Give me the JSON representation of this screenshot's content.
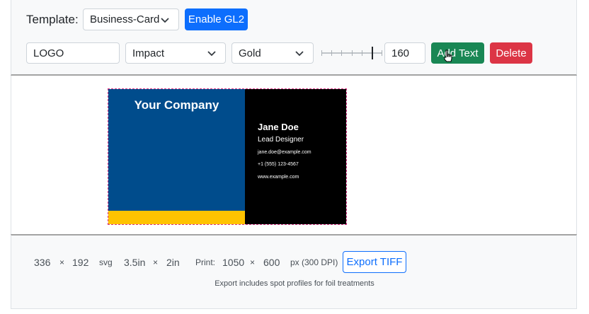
{
  "toolbar": {
    "template_label": "Template:",
    "template_value": "Business-Card",
    "enable_gl2_label": "Enable GL2",
    "text_value": "LOGO",
    "font_value": "Impact",
    "color_value": "Gold",
    "size_value": "160",
    "slider_level": 0.85,
    "add_text_label": "Add Text",
    "delete_label": "Delete"
  },
  "card": {
    "company": "Your Company",
    "name": "Jane Doe",
    "title": "Lead Designer",
    "email": "jane.doe@example.com",
    "phone": "+1 (555) 123-4567",
    "website": "www.example.com",
    "colors": {
      "left": "#004c8c",
      "stripe": "#ffc300",
      "right": "#000000"
    }
  },
  "footer": {
    "width_px": "336",
    "times1": "×",
    "height_px": "192",
    "format": "svg",
    "width_in": "3.5in",
    "times2": "×",
    "height_in": "2in",
    "print_label": "Print:",
    "print_w": "1050",
    "times3": "×",
    "print_h": "600",
    "print_unit": "px (300 DPI)",
    "export_label": "Export TIFF",
    "note": "Export includes spot profiles for foil treatments"
  }
}
